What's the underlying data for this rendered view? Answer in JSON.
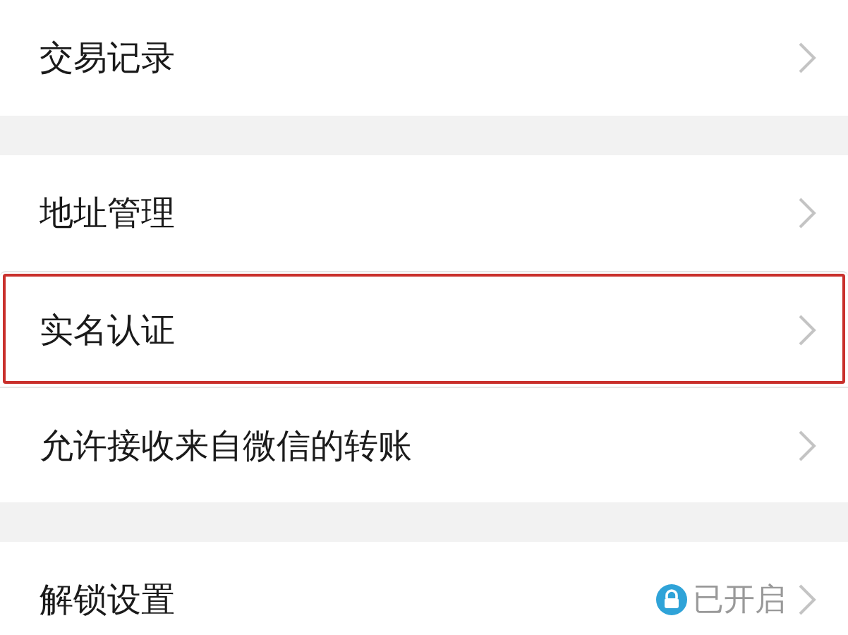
{
  "sections": [
    {
      "items": [
        {
          "label": "交易记录",
          "highlighted": false
        }
      ]
    },
    {
      "items": [
        {
          "label": "地址管理",
          "highlighted": false
        },
        {
          "label": "实名认证",
          "highlighted": true
        },
        {
          "label": "允许接收来自微信的转账",
          "highlighted": false
        }
      ]
    },
    {
      "items": [
        {
          "label": "解锁设置",
          "highlighted": false,
          "status": "已开启"
        }
      ]
    }
  ]
}
